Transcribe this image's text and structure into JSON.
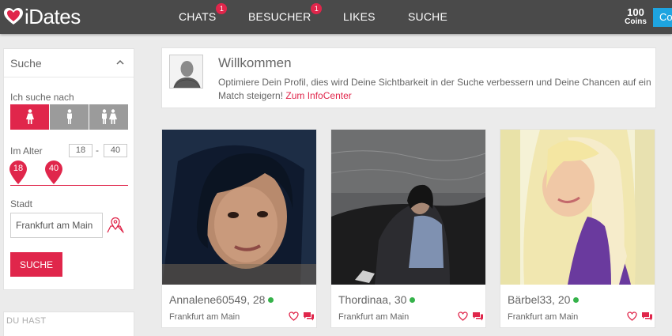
{
  "brand": {
    "name": "iDates",
    "accent": "#e0264b"
  },
  "nav": {
    "items": [
      {
        "label": "CHATS",
        "badge": "1"
      },
      {
        "label": "BESUCHER",
        "badge": "1"
      },
      {
        "label": "LIKES"
      },
      {
        "label": "SUCHE"
      }
    ]
  },
  "coins": {
    "value": "100",
    "label": "Coins"
  },
  "topbar_button": {
    "label": "Co"
  },
  "search": {
    "title": "Suche",
    "looking_for_label": "Ich suche nach",
    "gender_options": [
      "female",
      "male",
      "couple"
    ],
    "gender_selected": "female",
    "age_label": "Im Alter",
    "age_min": "18",
    "age_max": "40",
    "age_dash": "-",
    "slider_min_label": "18",
    "slider_max_label": "40",
    "city_label": "Stadt",
    "city_value": "Frankfurt am Main",
    "submit_label": "SUCHE"
  },
  "du_hast": {
    "label": "DU HAST"
  },
  "welcome": {
    "title": "Willkommen",
    "text": "Optimiere Dein Profil, dies wird Deine Sichtbarkeit in der Suche verbessern und Deine Chancen auf ein Match steigern! ",
    "link": "Zum InfoCenter"
  },
  "profiles": [
    {
      "name": "Annalene60549, 28",
      "city": "Frankfurt am Main",
      "online": true
    },
    {
      "name": "Thordinaa, 30",
      "city": "Frankfurt am Main",
      "online": true
    },
    {
      "name": "Bärbel33, 20",
      "city": "Frankfurt am Main",
      "online": true
    }
  ]
}
